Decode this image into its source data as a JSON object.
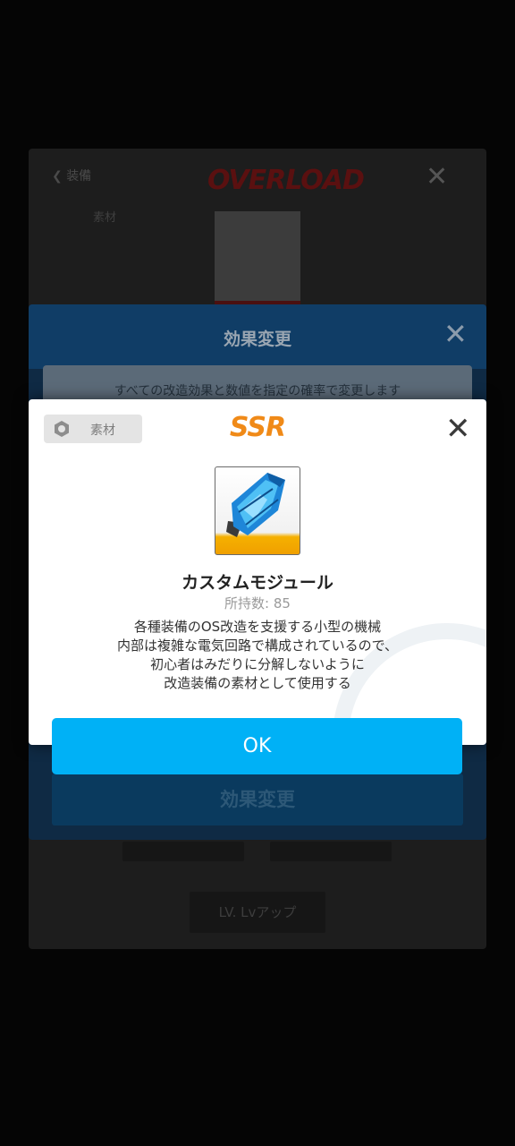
{
  "background": {
    "nav_label": "装備",
    "sub_label": "素材",
    "overload_logo": "OVERLOAD",
    "lv_button": "LV. Lvアップ"
  },
  "effect_panel": {
    "title": "効果変更",
    "description": "すべての改造効果と数値を指定の確率で変更します",
    "change_button": "効果変更"
  },
  "dialog": {
    "tag_label": "素材",
    "rarity": "SSR",
    "item_name": "カスタムモジュール",
    "count_text": "所持数: 85",
    "description_lines": [
      "各種装備のOS改造を支援する小型の機械",
      "内部は複雑な電気回路で構成されているので、",
      "初心者はみだりに分解しないように",
      "改造装備の素材として使用する"
    ],
    "ok_label": "OK",
    "item_icon": "blue-crystal-module-icon"
  },
  "colors": {
    "ok_button": "#00b1f6",
    "rarity": "#f08a18",
    "dialog_bg": "#ffffff"
  }
}
